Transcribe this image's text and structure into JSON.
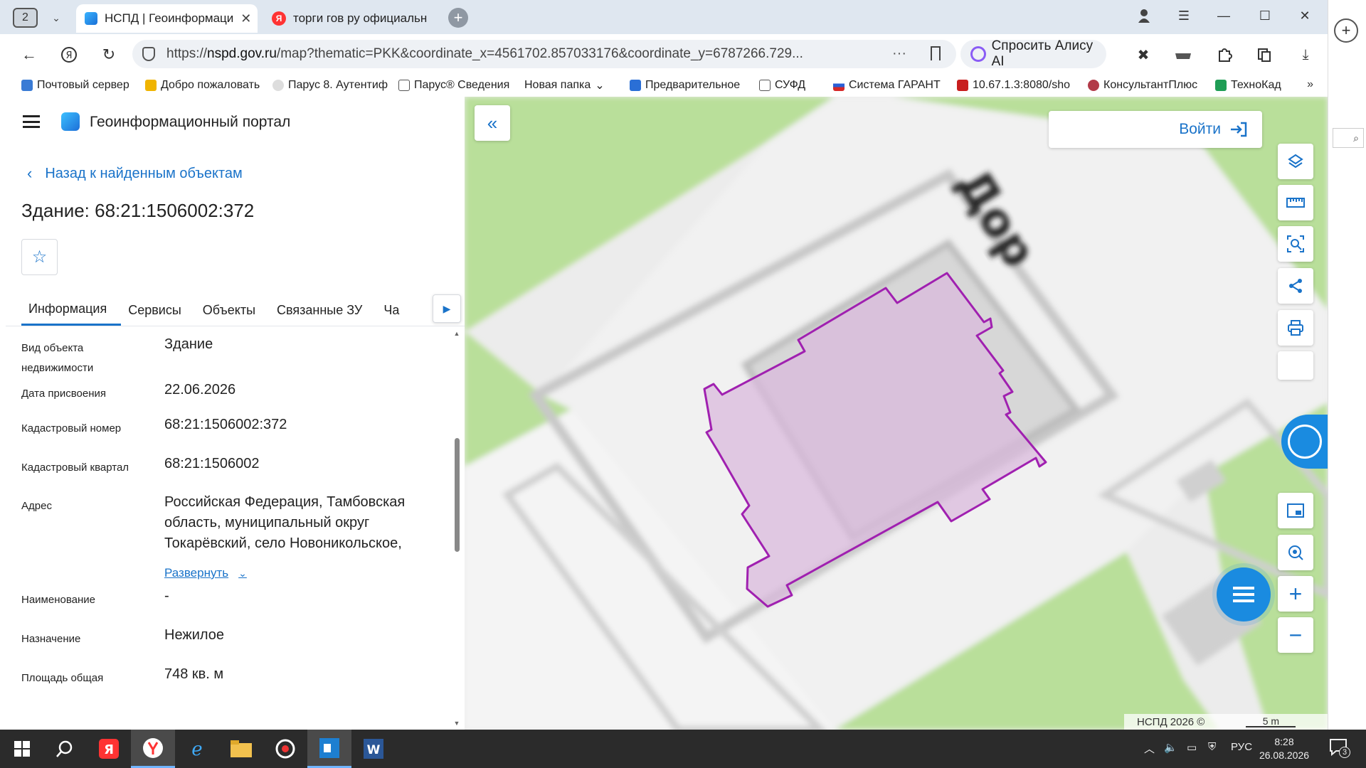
{
  "browser": {
    "tab_count": "2",
    "tabs": [
      {
        "title": "НСПД | Геоинформаци",
        "active": true
      },
      {
        "title": "торги гов ру официальн",
        "active": false
      }
    ],
    "url_scheme": "https://",
    "url_host": "nspd.gov.ru",
    "url_path": "/map?thematic=PKK&coordinate_x=4561702.857033176&coordinate_y=6787266.729...",
    "alice_label": "Спросить Алису AI",
    "bookmarks": [
      {
        "label": "Почтовый сервер",
        "color": "#3a7bd5"
      },
      {
        "label": "Добро пожаловать",
        "color": "#f0b400"
      },
      {
        "label": "Парус 8. Аутентиф",
        "color": "#444444"
      },
      {
        "label": "Парус® Сведения",
        "color": "#888888"
      },
      {
        "label": "Новая папка",
        "color": ""
      },
      {
        "label": "Предварительное",
        "color": "#2a6fd6"
      },
      {
        "label": "СУФД",
        "color": "#888888"
      },
      {
        "label": "Система ГАРАНТ",
        "color": "#d62828"
      },
      {
        "label": "10.67.1.3:8080/sho",
        "color": "#c81e1e"
      },
      {
        "label": "КонсультантПлюс",
        "color": "#b23a48"
      },
      {
        "label": "ТехноКад",
        "color": "#1f9d55"
      }
    ],
    "bookmarks_more": "»"
  },
  "portal": {
    "title": "Геоинформационный портал",
    "back_link": "Назад к найденным объектам",
    "object_title": "Здание: 68:21:1506002:372",
    "tabs": [
      "Информация",
      "Сервисы",
      "Объекты",
      "Связанные ЗУ",
      "Ча"
    ],
    "properties": [
      {
        "label": "Вид объекта недвижимости",
        "value": "Здание"
      },
      {
        "label": "Дата присвоения",
        "value": "22.06.2026"
      },
      {
        "label": "Кадастровый номер",
        "value": "68:21:1506002:372"
      },
      {
        "label": "Кадастровый квартал",
        "value": "68:21:1506002"
      },
      {
        "label": "Адрес",
        "value": "Российская Федерация, Тамбовская область, муниципальный округ Токарёвский, село Новоникольское,"
      },
      {
        "label": "Наименование",
        "value": "-"
      },
      {
        "label": "Назначение",
        "value": "Нежилое"
      },
      {
        "label": "Площадь общая",
        "value": "748 кв. м"
      }
    ],
    "expand_label": "Развернуть"
  },
  "map": {
    "login_label": "Войти",
    "copyright": "НСПД 2026 ©",
    "scale_label": "5 m",
    "road_label": "Дор",
    "colors": {
      "grass": "#b9df9a",
      "road": "#f3f3f3",
      "building_fill": "#d9b8dc",
      "building_stroke": "#a020b0",
      "accent": "#1a73c9"
    }
  },
  "taskbar": {
    "language": "РУС",
    "time": "8:28",
    "date": "26.08.2026",
    "notifications": "3"
  }
}
